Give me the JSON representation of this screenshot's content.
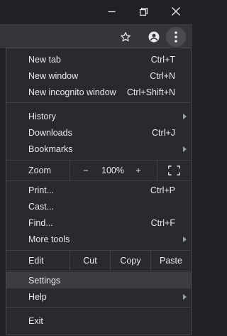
{
  "menu": {
    "new_tab": {
      "label": "New tab",
      "shortcut": "Ctrl+T"
    },
    "new_window": {
      "label": "New window",
      "shortcut": "Ctrl+N"
    },
    "new_incognito": {
      "label": "New incognito window",
      "shortcut": "Ctrl+Shift+N"
    },
    "history": {
      "label": "History"
    },
    "downloads": {
      "label": "Downloads",
      "shortcut": "Ctrl+J"
    },
    "bookmarks": {
      "label": "Bookmarks"
    },
    "zoom": {
      "label": "Zoom",
      "minus": "−",
      "level": "100%",
      "plus": "+"
    },
    "print": {
      "label": "Print...",
      "shortcut": "Ctrl+P"
    },
    "cast": {
      "label": "Cast..."
    },
    "find": {
      "label": "Find...",
      "shortcut": "Ctrl+F"
    },
    "more_tools": {
      "label": "More tools"
    },
    "edit": {
      "label": "Edit",
      "cut": "Cut",
      "copy": "Copy",
      "paste": "Paste"
    },
    "settings": {
      "label": "Settings"
    },
    "help": {
      "label": "Help"
    },
    "exit": {
      "label": "Exit"
    }
  },
  "colors": {
    "background": "#202124",
    "toolbar": "#35363a",
    "menu": "#292a2d",
    "highlight": "#3c3d41",
    "text": "#e8eaed"
  }
}
